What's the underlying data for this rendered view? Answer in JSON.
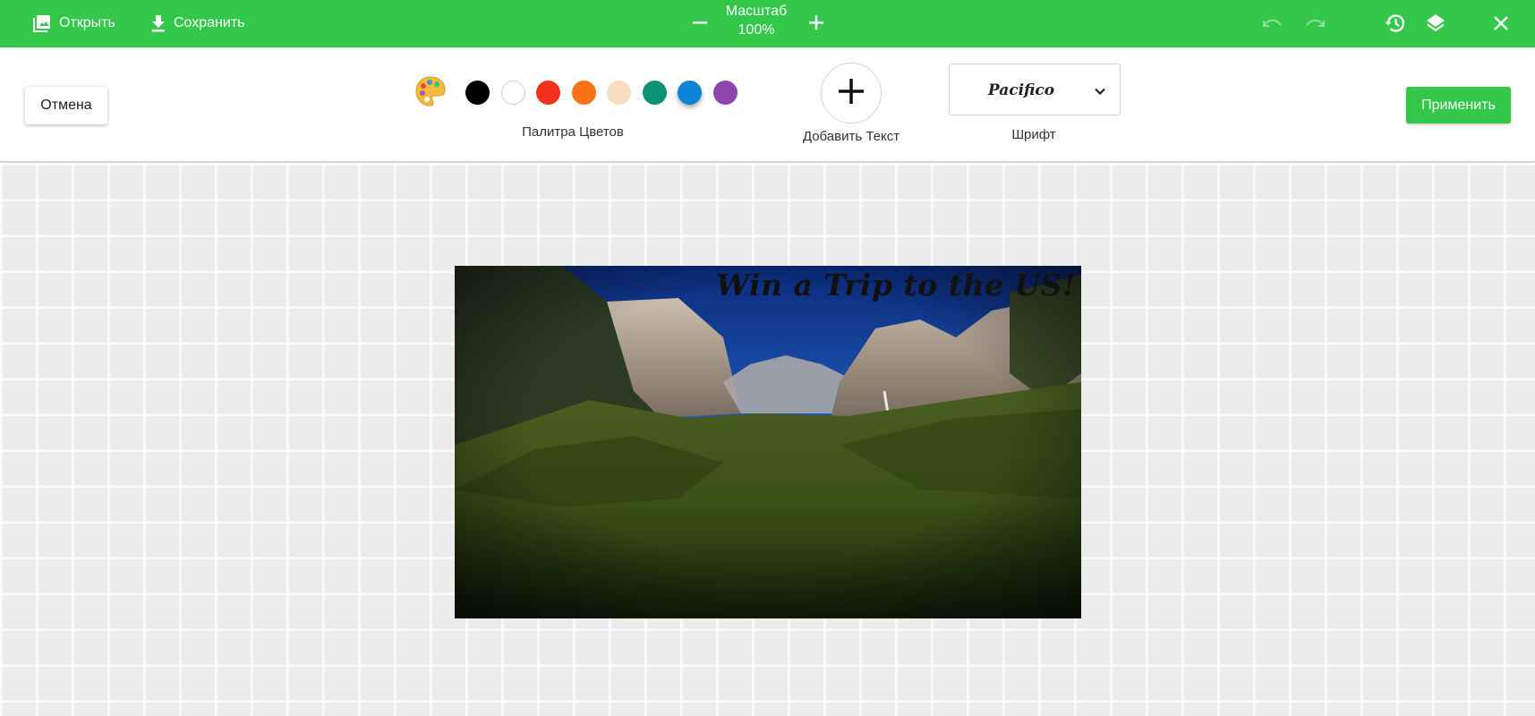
{
  "topbar": {
    "open_label": "Открыть",
    "save_label": "Сохранить",
    "zoom_label": "Масштаб",
    "zoom_value": "100%",
    "icons": [
      "image-icon",
      "download-icon",
      "minus-icon",
      "plus-icon",
      "undo-icon",
      "redo-icon",
      "history-icon",
      "layers-icon",
      "close-icon"
    ]
  },
  "toolbar": {
    "cancel_label": "Отмена",
    "apply_label": "Применить",
    "palette_caption": "Палитра Цветов",
    "colors": [
      "#000000",
      "#ffffff",
      "#f3301b",
      "#f97216",
      "#f7dcc1",
      "#0b9277",
      "#0d83d5",
      "#8e44ad"
    ],
    "selected_color": "#0d83d5",
    "add_text_caption": "Добавить Текст",
    "font_value": "Pacifico",
    "font_caption": "Шрифт"
  },
  "canvas": {
    "overlay_text": "Win a Trip to the US!"
  },
  "colors": {
    "accent": "#34c84a"
  }
}
